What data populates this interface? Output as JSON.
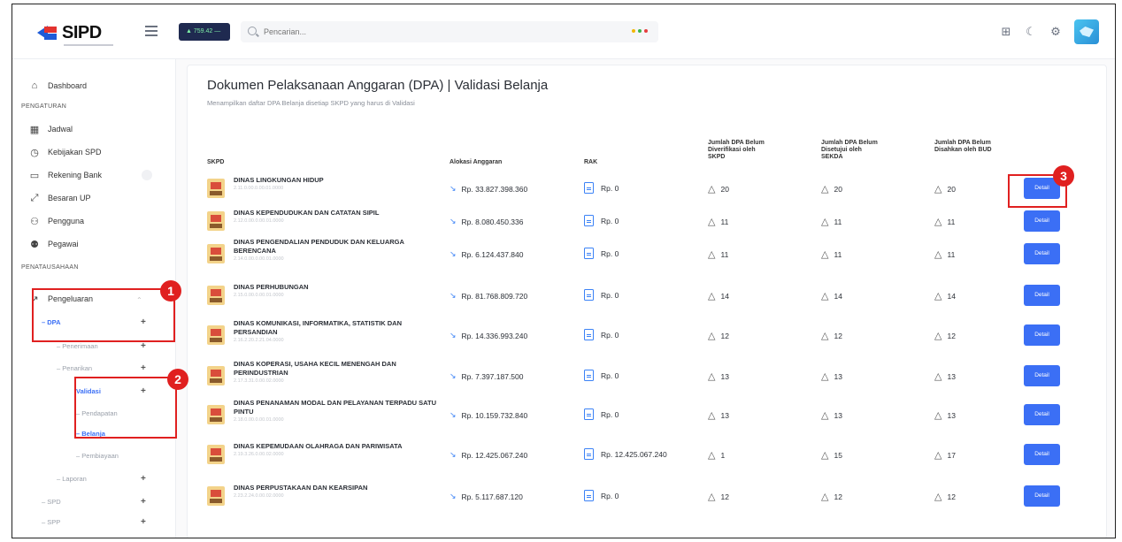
{
  "header": {
    "logo_text": "SIPD",
    "chip_text": "▲ 759.42 —",
    "search_placeholder": "Pencarian...",
    "status_dot_colors": [
      "#f2b705",
      "#3bb54a",
      "#e53e3e"
    ],
    "icons": [
      "layout-icon",
      "moon-icon",
      "settings-icon",
      "avatar"
    ]
  },
  "sidebar": {
    "dashboard": "Dashboard",
    "section_pengaturan": "PENGATURAN",
    "jadwal": "Jadwal",
    "kebijakan": "Kebijakan SPD",
    "rekening": "Rekening Bank",
    "besaran": "Besaran UP",
    "pengguna": "Pengguna",
    "pegawai": "Pegawai",
    "section_penatausahaan": "PENATAUSAHAAN",
    "pengeluaran": "Pengeluaran",
    "dpa": "DPA",
    "penerimaan": "Penerimaan",
    "penarikan": "Penarikan",
    "validasi": "Validasi",
    "pendapatan": "Pendapatan",
    "belanja": "Belanja",
    "pembiayaan": "Pembiayaan",
    "laporan": "Laporan",
    "spd": "SPD",
    "spp": "SPP"
  },
  "page": {
    "title": "Dokumen Pelaksanaan Anggaran (DPA) | Validasi Belanja",
    "subtitle": "Menampilkan daftar DPA Belanja disetiap SKPD yang harus di Validasi"
  },
  "table": {
    "headers": {
      "skpd": "SKPD",
      "alokasi": "Alokasi Anggaran",
      "rak": "RAK",
      "col1": "Jumlah DPA Belum Diverifikasi oleh SKPD",
      "col2": "Jumlah DPA Belum Disetujui oleh SEKDA",
      "col3": "Jumlah DPA Belum Disahkan oleh BUD"
    },
    "detail_label": "Detail",
    "rows": [
      {
        "name": "DINAS LINGKUNGAN HIDUP",
        "code": "2.11.0.00.0.00.01.0000",
        "alokasi": "Rp. 33.827.398.360",
        "rak": "Rp. 0",
        "c1": "20",
        "c2": "20",
        "c3": "20"
      },
      {
        "name": "DINAS KEPENDUDUKAN DAN CATATAN SIPIL",
        "code": "2.12.0.00.0.00.01.0000",
        "alokasi": "Rp. 8.080.450.336",
        "rak": "Rp. 0",
        "c1": "11",
        "c2": "11",
        "c3": "11"
      },
      {
        "name": "DINAS PENGENDALIAN PENDUDUK DAN KELUARGA BERENCANA",
        "code": "2.14.0.00.0.00.01.0000",
        "alokasi": "Rp. 6.124.437.840",
        "rak": "Rp. 0",
        "c1": "11",
        "c2": "11",
        "c3": "11"
      },
      {
        "name": "DINAS PERHUBUNGAN",
        "code": "2.15.0.00.0.00.01.0000",
        "alokasi": "Rp. 81.768.809.720",
        "rak": "Rp. 0",
        "c1": "14",
        "c2": "14",
        "c3": "14"
      },
      {
        "name": "DINAS KOMUNIKASI, INFORMATIKA, STATISTIK DAN PERSANDIAN",
        "code": "2.16.2.20.2.21.04.0000",
        "alokasi": "Rp. 14.336.993.240",
        "rak": "Rp. 0",
        "c1": "12",
        "c2": "12",
        "c3": "12"
      },
      {
        "name": "DINAS KOPERASI, USAHA KECIL MENENGAH DAN PERINDUSTRIAN",
        "code": "2.17.3.31.0.00.02.0000",
        "alokasi": "Rp. 7.397.187.500",
        "rak": "Rp. 0",
        "c1": "13",
        "c2": "13",
        "c3": "13"
      },
      {
        "name": "DINAS PENANAMAN MODAL DAN PELAYANAN TERPADU SATU PINTU",
        "code": "2.18.0.00.0.00.01.0000",
        "alokasi": "Rp. 10.159.732.840",
        "rak": "Rp. 0",
        "c1": "13",
        "c2": "13",
        "c3": "13"
      },
      {
        "name": "DINAS KEPEMUDAAN OLAHRAGA DAN PARIWISATA",
        "code": "2.19.3.26.0.00.02.0000",
        "alokasi": "Rp. 12.425.067.240",
        "rak": "Rp. 12.425.067.240",
        "c1": "1",
        "c2": "15",
        "c3": "17"
      },
      {
        "name": "DINAS PERPUSTAKAAN DAN KEARSIPAN",
        "code": "2.23.2.24.0.00.02.0000",
        "alokasi": "Rp. 5.117.687.120",
        "rak": "Rp. 0",
        "c1": "12",
        "c2": "12",
        "c3": "12"
      }
    ]
  },
  "annotations": {
    "badge1": "1",
    "badge2": "2",
    "badge3": "3",
    "color": "#e02020"
  },
  "colors": {
    "primary": "#3b6ff5",
    "trend": "#3b82f6"
  }
}
